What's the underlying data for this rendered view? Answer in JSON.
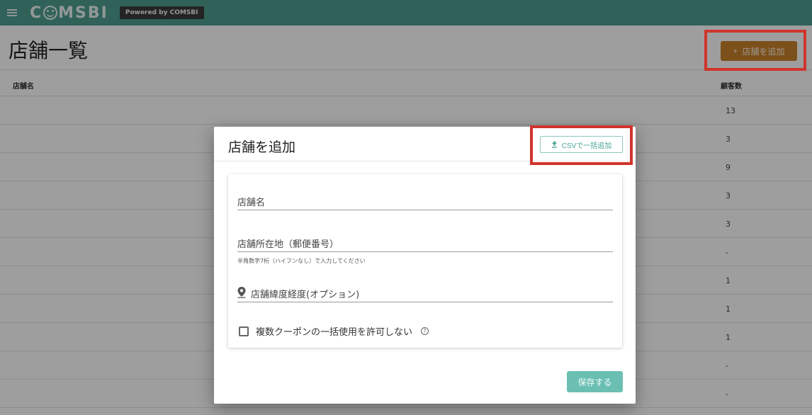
{
  "header": {
    "logo_text": "COMSBI",
    "powered_label": "Powered by COMSBI"
  },
  "page": {
    "title": "店舗一覧",
    "add_button_icon": "+",
    "add_button_label": "店舗を追加"
  },
  "table": {
    "columns": [
      "店舗名",
      "顧客数"
    ],
    "rows": [
      {
        "customers": "13"
      },
      {
        "customers": "3"
      },
      {
        "customers": "9"
      },
      {
        "customers": "3"
      },
      {
        "customers": "3"
      },
      {
        "customers": "-"
      },
      {
        "customers": "1"
      },
      {
        "customers": "1"
      },
      {
        "customers": "1"
      },
      {
        "customers": "-"
      },
      {
        "customers": "-"
      }
    ]
  },
  "modal": {
    "title": "店舗を追加",
    "csv_icon": "upload-icon",
    "csv_button_label": "CSVで一括追加",
    "fields": {
      "name_label": "店舗名",
      "postal_label": "店舗所在地（郵便番号）",
      "postal_hint": "半角数字7桁（ハイフンなし）で入力してください",
      "latlng_label": "店舗緯度経度(オプション)"
    },
    "checkbox_label": "複数クーポンの一括使用を許可しない",
    "help_glyph": "?",
    "save_label": "保存する"
  },
  "colors": {
    "header": "#4f9e92",
    "accent_orange": "#c7812a",
    "accent_teal": "#6bbfb2",
    "highlight_red": "#d0342c"
  }
}
